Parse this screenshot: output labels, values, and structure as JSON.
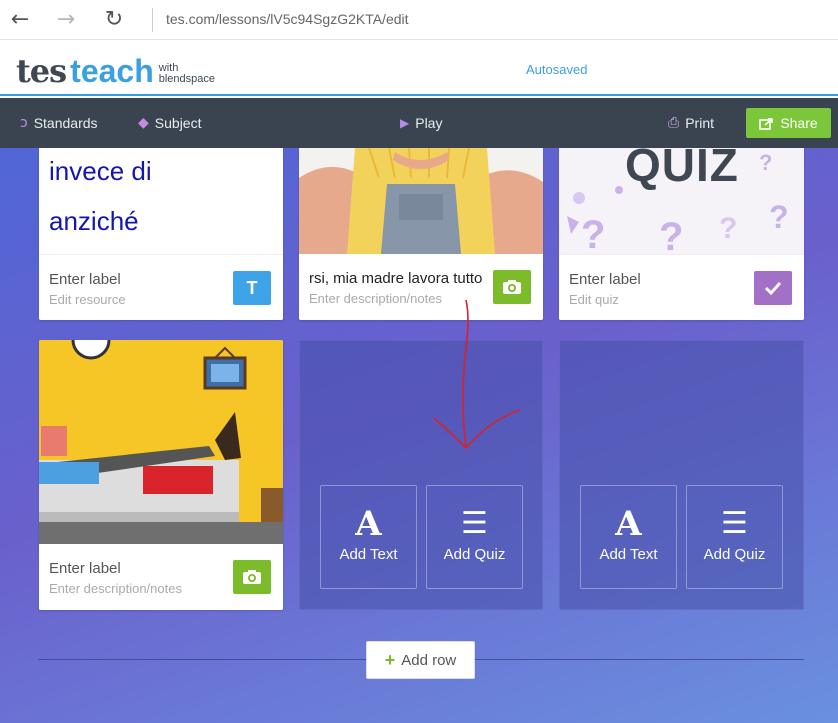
{
  "browser": {
    "url": "tes.com/lessons/lV5c94SgzG2KTA/edit"
  },
  "header": {
    "logo_tes": "tes",
    "logo_teach": "teach",
    "logo_with": "with",
    "logo_blendspace": "blendspace",
    "status": "Autosaved"
  },
  "toolbar": {
    "standards": "Standards",
    "subject": "Subject",
    "play": "Play",
    "print": "Print",
    "share": "Share"
  },
  "cards": [
    {
      "text_lines": [
        "invece di",
        "anziché"
      ],
      "label": "Enter label",
      "sub": "Edit resource",
      "badge": "T",
      "badge_color": "#3fa3ea"
    },
    {
      "label": "rsi, mia madre lavora tutto",
      "sub": "Enter description/notes",
      "badge_icon": "camera-icon",
      "badge_color": "#7cbb2a"
    },
    {
      "media_text": "QUIZ",
      "label": "Enter label",
      "sub": "Edit quiz",
      "badge_icon": "check-icon",
      "badge_color": "#a270c7"
    },
    {
      "label": "Enter label",
      "sub": "Enter description/notes",
      "badge_icon": "camera-icon",
      "badge_color": "#7cbb2a"
    }
  ],
  "empty_slots": [
    {
      "add_text": "Add Text",
      "add_quiz": "Add Quiz"
    },
    {
      "add_text": "Add Text",
      "add_quiz": "Add Quiz"
    }
  ],
  "add_row": "Add row",
  "colors": {
    "accent_blue": "#3b9fe0",
    "share_green": "#7cc639",
    "toolbar": "#3a4450",
    "annotation": "#d8212a"
  }
}
